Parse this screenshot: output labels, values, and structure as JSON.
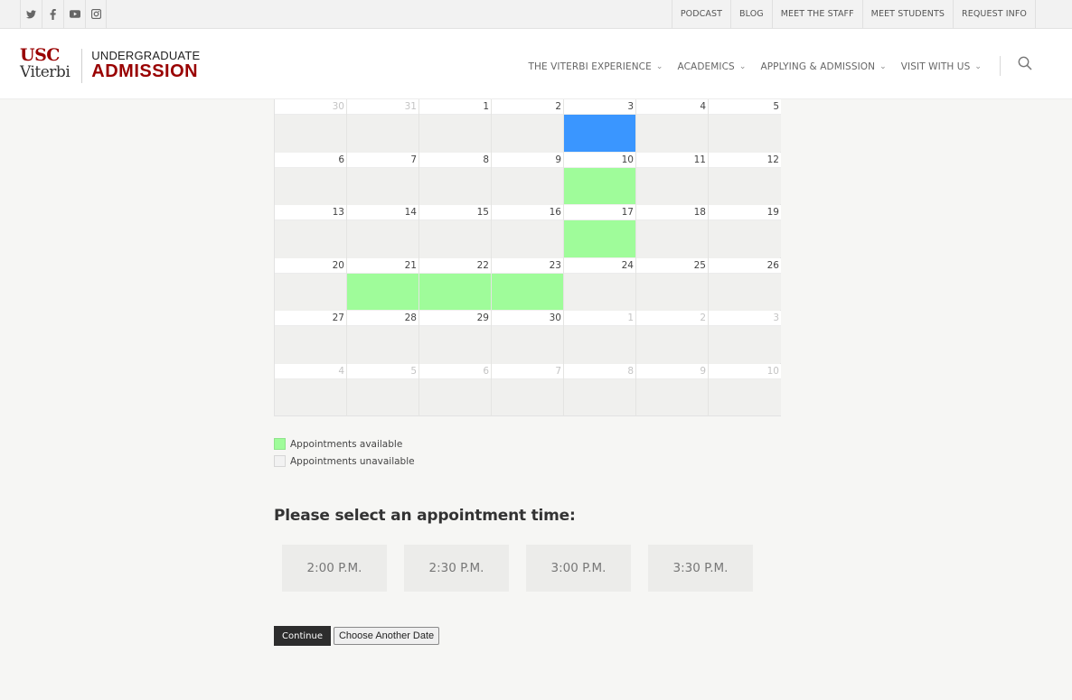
{
  "social": [
    {
      "icon": "twitter-icon"
    },
    {
      "icon": "facebook-icon"
    },
    {
      "icon": "youtube-icon"
    },
    {
      "icon": "instagram-icon"
    }
  ],
  "top_links": [
    "PODCAST",
    "BLOG",
    "MEET THE STAFF",
    "MEET STUDENTS",
    "REQUEST INFO"
  ],
  "logo": {
    "line1": "USC",
    "line2": "Viterbi",
    "line3": "UNDERGRADUATE",
    "line4": "ADMISSION"
  },
  "nav": [
    {
      "label": "THE VITERBI EXPERIENCE",
      "chevron": "⌄"
    },
    {
      "label": "ACADEMICS",
      "chevron": "⌄"
    },
    {
      "label": "APPLYING & ADMISSION",
      "chevron": "⌄"
    },
    {
      "label": "VISIT WITH US",
      "chevron": "⌄"
    }
  ],
  "calendar": {
    "weeks": [
      [
        {
          "d": "30",
          "other": true
        },
        {
          "d": "31",
          "other": true
        },
        {
          "d": "1"
        },
        {
          "d": "2"
        },
        {
          "d": "3",
          "state": "selected"
        },
        {
          "d": "4"
        },
        {
          "d": "5"
        }
      ],
      [
        {
          "d": "6"
        },
        {
          "d": "7"
        },
        {
          "d": "8"
        },
        {
          "d": "9"
        },
        {
          "d": "10",
          "state": "available"
        },
        {
          "d": "11"
        },
        {
          "d": "12"
        }
      ],
      [
        {
          "d": "13"
        },
        {
          "d": "14"
        },
        {
          "d": "15"
        },
        {
          "d": "16"
        },
        {
          "d": "17",
          "state": "available"
        },
        {
          "d": "18"
        },
        {
          "d": "19"
        }
      ],
      [
        {
          "d": "20"
        },
        {
          "d": "21",
          "state": "available"
        },
        {
          "d": "22",
          "state": "available"
        },
        {
          "d": "23",
          "state": "available"
        },
        {
          "d": "24"
        },
        {
          "d": "25"
        },
        {
          "d": "26"
        }
      ],
      [
        {
          "d": "27"
        },
        {
          "d": "28"
        },
        {
          "d": "29"
        },
        {
          "d": "30"
        },
        {
          "d": "1",
          "other": true
        },
        {
          "d": "2",
          "other": true
        },
        {
          "d": "3",
          "other": true
        }
      ],
      [
        {
          "d": "4",
          "other": true
        },
        {
          "d": "5",
          "other": true
        },
        {
          "d": "6",
          "other": true
        },
        {
          "d": "7",
          "other": true
        },
        {
          "d": "8",
          "other": true
        },
        {
          "d": "9",
          "other": true
        },
        {
          "d": "10",
          "other": true
        }
      ]
    ],
    "colors": {
      "available": "#9ffc9a",
      "selected": "#3a96ff",
      "unavailable": "#f0f0ee"
    }
  },
  "legend": {
    "available": "Appointments available",
    "unavailable": "Appointments unavailable"
  },
  "section_title": "Please select an appointment time:",
  "times": [
    "2:00 P.M.",
    "2:30 P.M.",
    "3:00 P.M.",
    "3:30 P.M."
  ],
  "actions": {
    "continue": "Continue",
    "choose_other": "Choose Another Date"
  }
}
